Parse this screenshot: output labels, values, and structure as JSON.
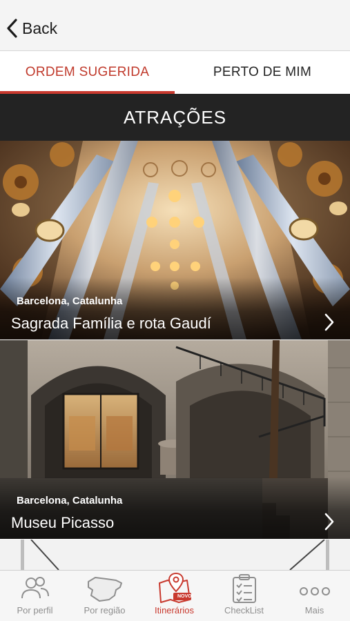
{
  "nav": {
    "back_label": "Back"
  },
  "tabs": [
    {
      "label": "ORDEM SUGERIDA",
      "active": true
    },
    {
      "label": "PERTO DE MIM",
      "active": false
    }
  ],
  "section": {
    "title": "ATRAÇÕES"
  },
  "cards": [
    {
      "location": "Barcelona, Catalunha",
      "title": "Sagrada Família e rota Gaudí"
    },
    {
      "location": "Barcelona, Catalunha",
      "title": "Museu Picasso"
    }
  ],
  "tabbar": {
    "items": [
      {
        "label": "Por perfil",
        "icon": "people-icon",
        "active": false
      },
      {
        "label": "Por região",
        "icon": "spain-map-icon",
        "active": false
      },
      {
        "label": "Itinerários",
        "icon": "map-pin-icon",
        "badge": "NOVO!",
        "active": true
      },
      {
        "label": "CheckList",
        "icon": "clipboard-icon",
        "active": false
      },
      {
        "label": "Mais",
        "icon": "more-dots-icon",
        "active": false
      }
    ]
  },
  "colors": {
    "accent": "#c8392e",
    "header": "#232323",
    "tab_inactive": "#8e8e8e"
  }
}
